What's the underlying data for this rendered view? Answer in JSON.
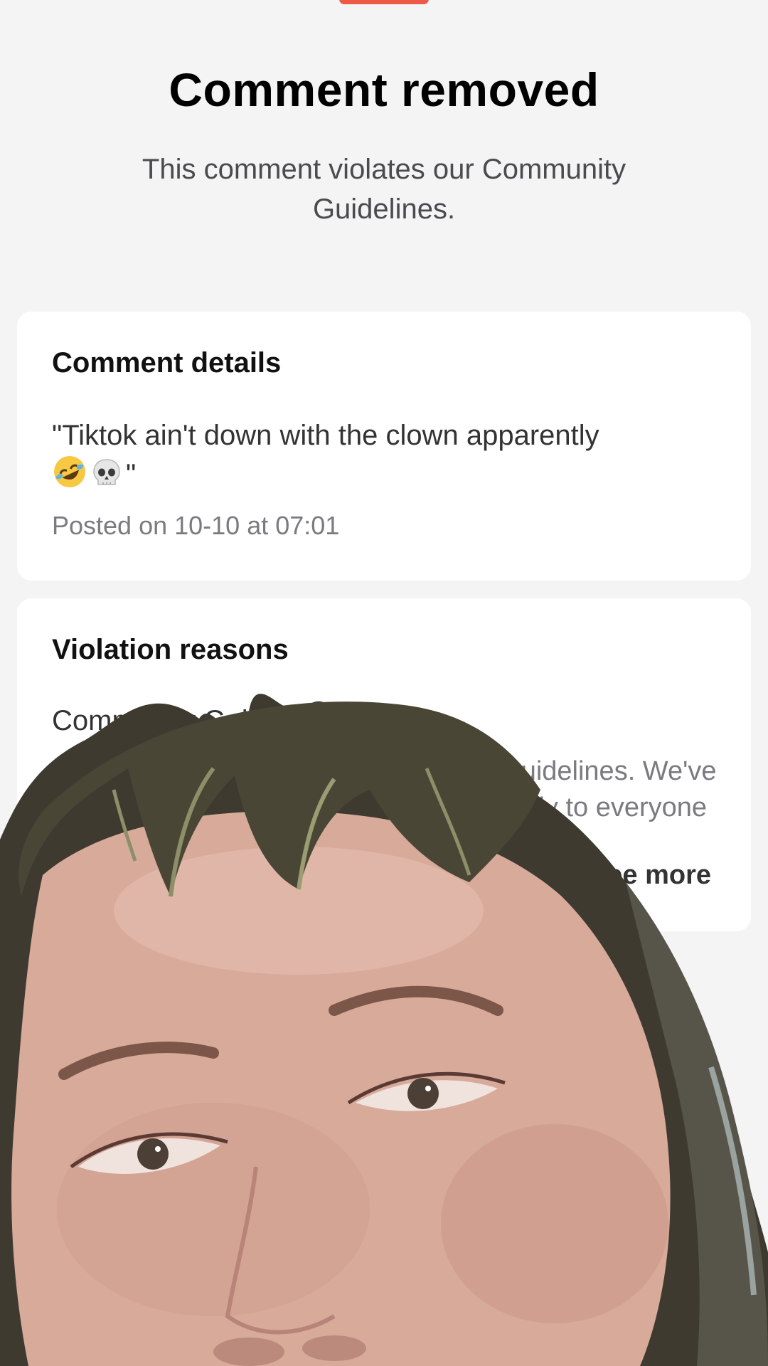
{
  "header": {
    "title": "Comment removed",
    "subtitle": "This comment violates our Community Guidelines."
  },
  "comment_details": {
    "heading": "Comment details",
    "text": "\"Tiktok ain't down with the clown apparently",
    "emojis": [
      "rolling-on-floor-laughing-emoji",
      "skull-emoji"
    ],
    "closing_quote": "\"",
    "posted": "Posted on 10-10 at 07:01"
  },
  "violation": {
    "heading": "Violation reasons",
    "reason_title": "Community Guidelines",
    "reason_description": "Your content violates our Community Guidelines. We've established rules and standards that apply to everyone",
    "see_more_label": "See more"
  },
  "colors": {
    "background": "#f4f4f4",
    "card": "#ffffff",
    "accent": "#ee5a4a",
    "muted_text": "#7a7a80"
  }
}
